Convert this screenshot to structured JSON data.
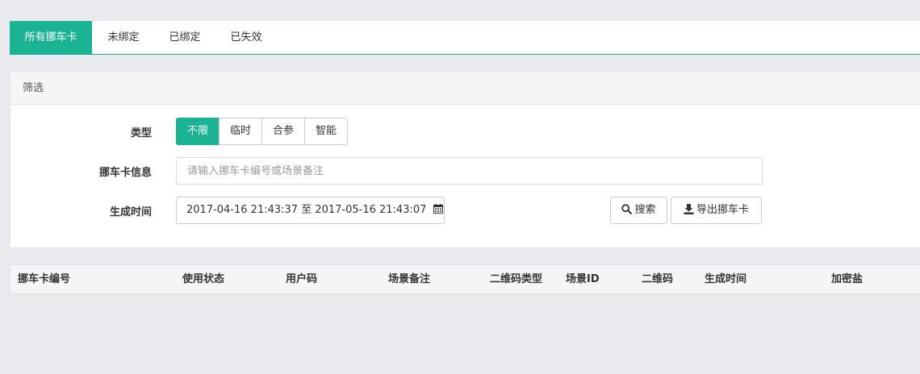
{
  "tabs": [
    {
      "label": "所有挪车卡",
      "active": true
    },
    {
      "label": "未绑定",
      "active": false
    },
    {
      "label": "已绑定",
      "active": false
    },
    {
      "label": "已失效",
      "active": false
    }
  ],
  "filter": {
    "title": "筛选",
    "type_label": "类型",
    "type_options": [
      "不限",
      "临时",
      "合参",
      "智能"
    ],
    "type_selected": "不限",
    "info_label": "挪车卡信息",
    "info_placeholder": "请输入挪车卡编号或场景备注",
    "info_value": "",
    "time_label": "生成时间",
    "time_range": "2017-04-16 21:43:37 至 2017-05-16 21:43:07",
    "search_button": "搜索",
    "export_button": "导出挪车卡"
  },
  "table": {
    "columns": [
      "挪车卡编号",
      "使用状态",
      "用户码",
      "场景备注",
      "二维码类型",
      "场景ID",
      "二维码",
      "生成时间",
      "加密盐"
    ],
    "rows": []
  },
  "colors": {
    "accent": "#1ab394",
    "background": "#e9eaee"
  }
}
